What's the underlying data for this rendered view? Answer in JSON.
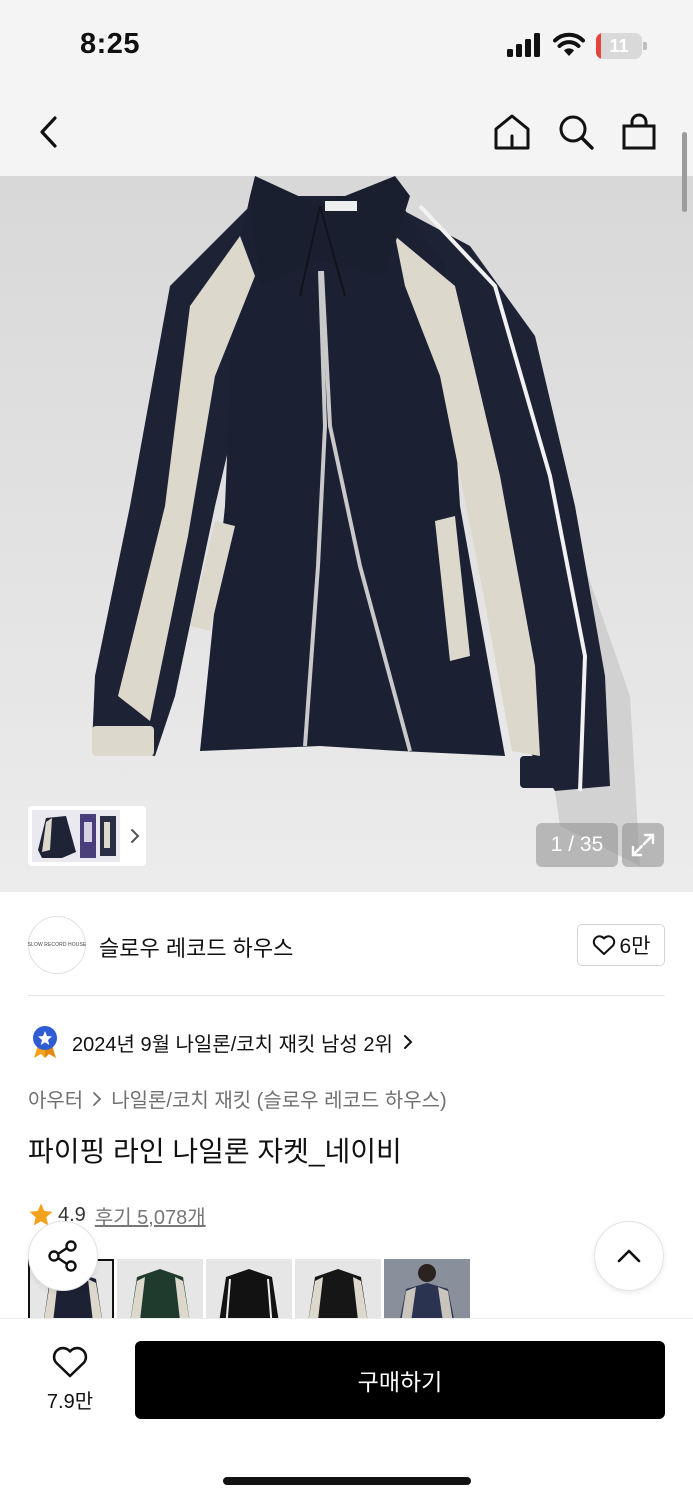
{
  "status_bar": {
    "time": "8:25",
    "battery": "11",
    "battery_level": 0.11
  },
  "product_images": {
    "counter": "1 / 35"
  },
  "brand": {
    "logo_text": "SLOW RECORD HOUSE",
    "name": "슬로우 레코드 하우스",
    "likes": "6만"
  },
  "ranking": {
    "text": "2024년 9월 나일론/코치 재킷 남성 2위"
  },
  "breadcrumb": {
    "category": "아우터",
    "subcategory": "나일론/코치 재킷 (슬로우 레코드 하우스)"
  },
  "product": {
    "title": "파이핑 라인 나일론 자켓_네이비",
    "rating": "4.9",
    "reviews": "후기 5,078개"
  },
  "bottom_bar": {
    "wish_count": "7.9만",
    "buy_label": "구매하기"
  },
  "colors": {
    "accent": "#000000",
    "badge_blue": "#2f5bd3",
    "star": "#f4a21d",
    "battery_low": "#e5443b"
  }
}
